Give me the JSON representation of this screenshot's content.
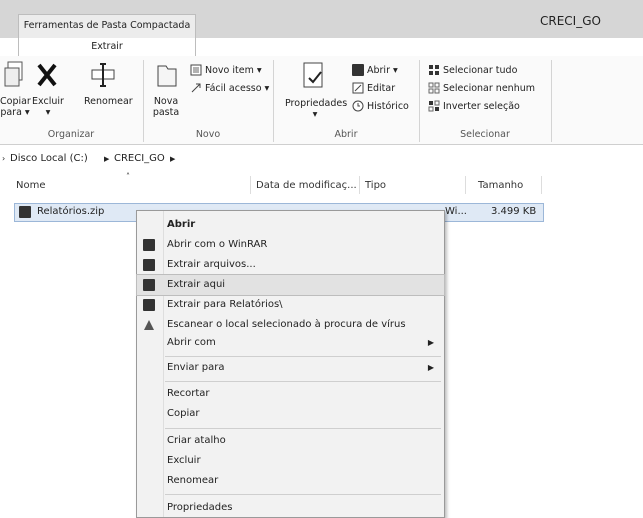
{
  "title_bar": {
    "context_tab": "Ferramentas de Pasta Compactada",
    "window_title": "CRECI_GO"
  },
  "tabs": {
    "active": "Extrair"
  },
  "ribbon": {
    "organizar": {
      "copiar": "Copiar para ▾",
      "excluir": "Excluir",
      "renomear": "Renomear",
      "group": "Organizar"
    },
    "novo": {
      "nova_pasta": "Nova pasta",
      "novo_item": "Novo item ▾",
      "facil_acesso": "Fácil acesso ▾",
      "group": "Novo"
    },
    "abrir": {
      "propriedades": "Propriedades",
      "abrir": "Abrir ▾",
      "editar": "Editar",
      "historico": "Histórico",
      "group": "Abrir"
    },
    "selecionar": {
      "tudo": "Selecionar tudo",
      "nenhum": "Selecionar nenhum",
      "inverter": "Inverter seleção",
      "group": "Selecionar"
    }
  },
  "address": {
    "root": "Disco Local (C:)",
    "folder": "CRECI_GO"
  },
  "columns": {
    "name": "Nome",
    "date": "Data de modificaç...",
    "type": "Tipo",
    "size": "Tamanho"
  },
  "file": {
    "name": "Relatórios.zip",
    "type_partial": "Wi...",
    "size": "3.499 KB"
  },
  "context_menu": {
    "abrir": "Abrir",
    "abrir_winrar": "Abrir com o WinRAR",
    "extrair_arquivos": "Extrair arquivos...",
    "extrair_aqui": "Extrair aqui",
    "extrair_para": "Extrair para Relatórios\\",
    "escanear": "Escanear o local selecionado à procura de vírus",
    "abrir_com": "Abrir com",
    "enviar_para": "Enviar para",
    "recortar": "Recortar",
    "copiar": "Copiar",
    "criar_atalho": "Criar atalho",
    "excluir": "Excluir",
    "renomear": "Renomear",
    "propriedades": "Propriedades"
  },
  "colors": {
    "selected_row": "#dfe9f5",
    "highlight": "#e2e2e2",
    "menu_bg": "#f2f2f2"
  }
}
